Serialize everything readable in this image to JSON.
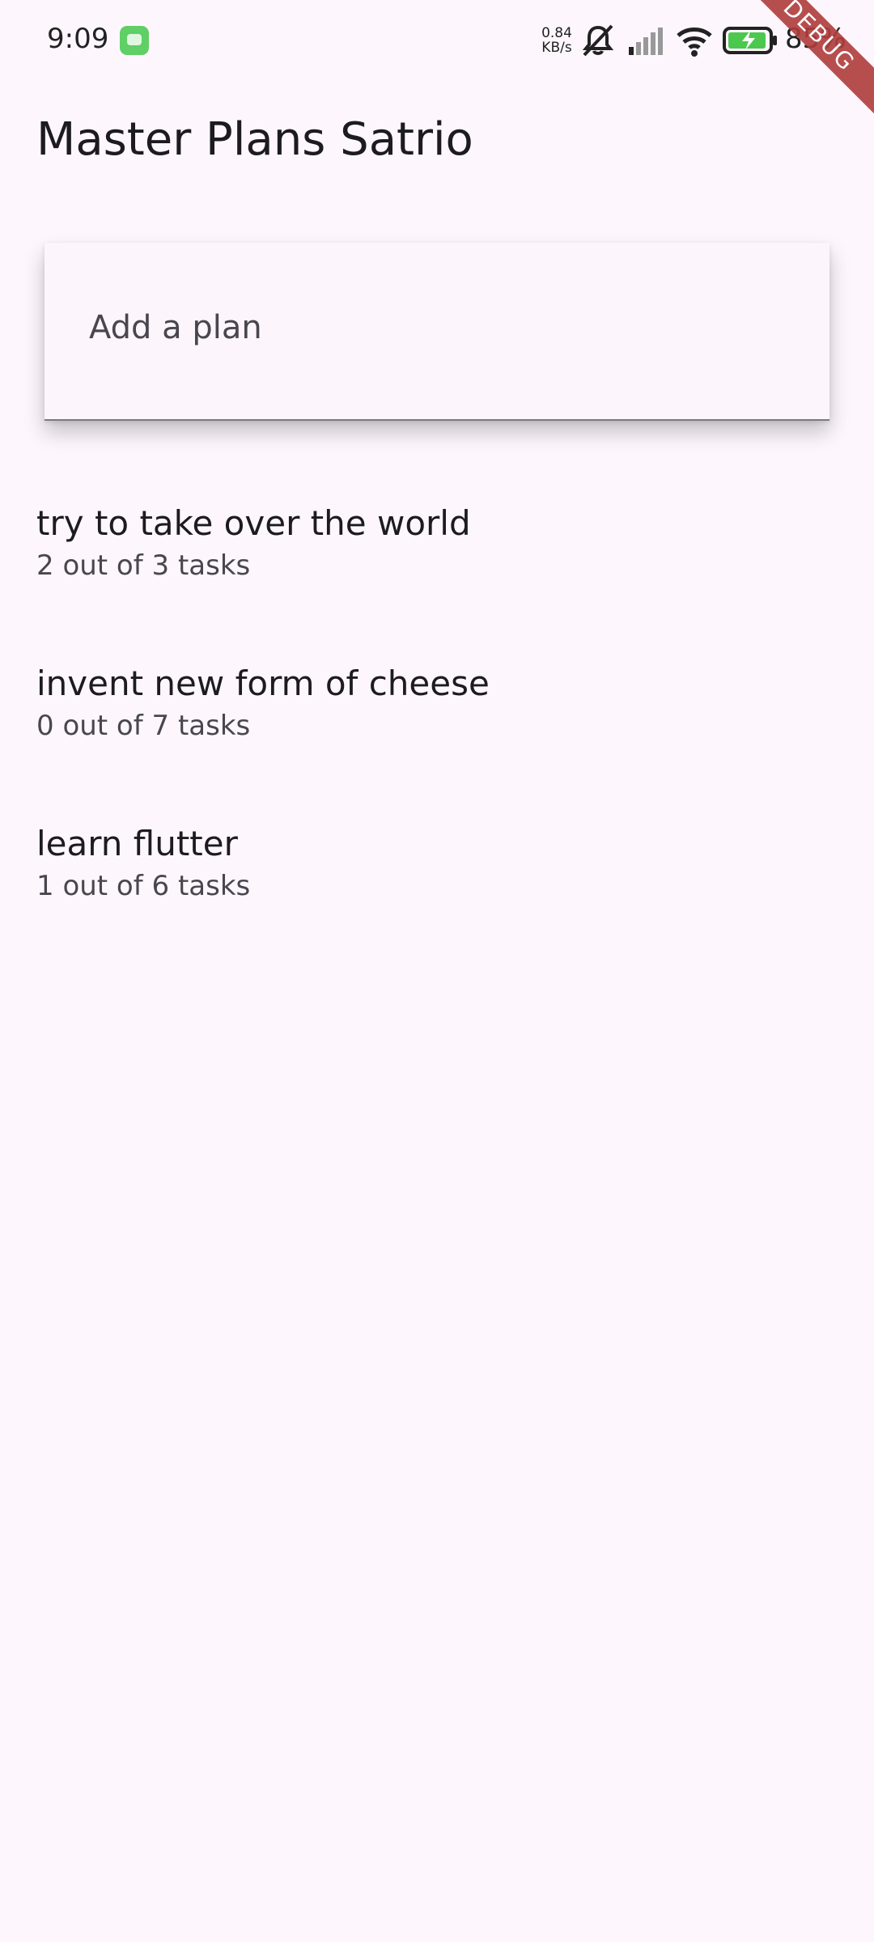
{
  "status_bar": {
    "time": "9:09",
    "net_speed_value": "0.84",
    "net_speed_unit": "KB/s",
    "battery_percent": "85%"
  },
  "debug_banner": "DEBUG",
  "app_bar": {
    "title": "Master Plans Satrio"
  },
  "add_plan": {
    "placeholder": "Add a plan"
  },
  "plans": [
    {
      "title": "try to take over the world",
      "progress": "2 out of 3 tasks"
    },
    {
      "title": "invent new form of cheese",
      "progress": "0 out of 7 tasks"
    },
    {
      "title": "learn flutter",
      "progress": "1 out of 6 tasks"
    }
  ],
  "colors": {
    "background": "#fdf7fd",
    "card": "#fcf6fc",
    "debug_banner": "#b03c3c"
  }
}
